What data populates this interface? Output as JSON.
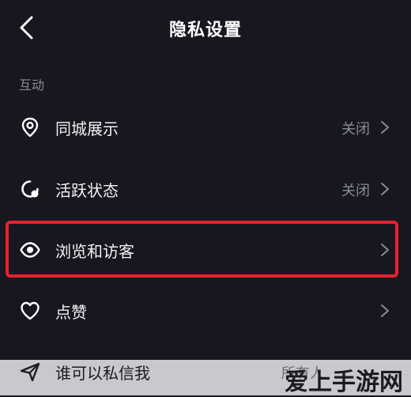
{
  "header": {
    "title": "隐私设置",
    "back_icon": "chevron-left-icon"
  },
  "section": {
    "label": "互动"
  },
  "items": [
    {
      "label": "同城展示",
      "value": "关闭",
      "icon": "location-pin-icon"
    },
    {
      "label": "活跃状态",
      "value": "关闭",
      "icon": "activity-status-icon"
    },
    {
      "label": "浏览和访客",
      "value": "",
      "icon": "eye-icon"
    },
    {
      "label": "点赞",
      "value": "",
      "icon": "heart-icon"
    },
    {
      "label": "谁可以私信我",
      "value": "所有人",
      "icon": "send-icon"
    }
  ],
  "watermark": "爱上手游网",
  "colors": {
    "background": "#16171f",
    "highlight": "#e8202c",
    "secondary_text": "#8a8b93"
  }
}
